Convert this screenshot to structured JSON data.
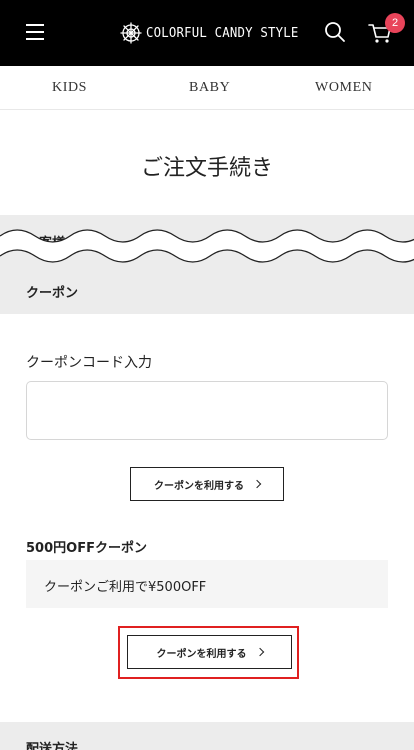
{
  "header": {
    "brand": "COLORFUL CANDY STYLE",
    "cart_count": "2",
    "icons": {
      "menu": "hamburger-menu-icon",
      "search": "search-icon",
      "cart": "cart-icon",
      "logo": "snowflake-logo-icon"
    }
  },
  "nav": {
    "items": [
      "KIDS",
      "BABY",
      "WOMEN"
    ]
  },
  "page": {
    "title": "ご注文手続き"
  },
  "sections": {
    "customer_info": "お客様の情報",
    "coupon": "クーポン",
    "delivery": "配送方法"
  },
  "coupon": {
    "code_label": "クーポンコード入力",
    "code_value": "",
    "apply_label": "クーポンを利用する",
    "offer_title": "500円OFFクーポン",
    "offer_description": "クーポンご利用で¥500OFF",
    "offer_apply_label": "クーポンを利用する"
  },
  "colors": {
    "header_bg": "#000000",
    "badge": "#e8445a",
    "section_band": "#ececec",
    "highlight": "#e02020"
  }
}
